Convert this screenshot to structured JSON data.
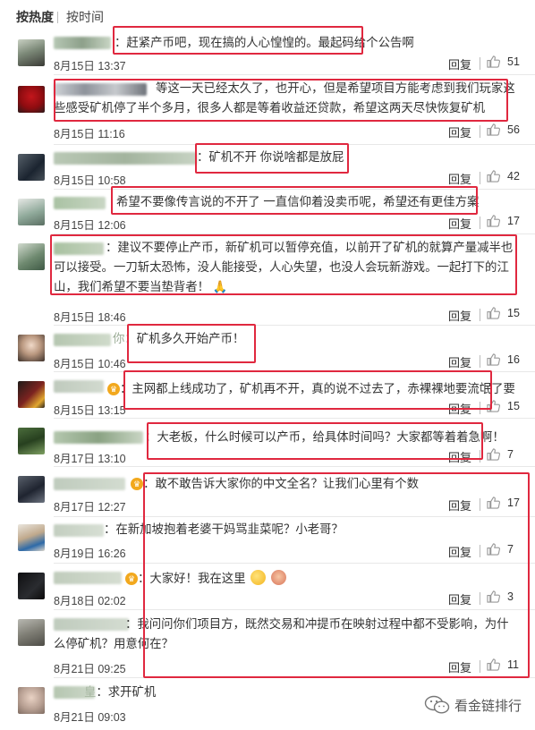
{
  "sort": {
    "hot": "按热度",
    "time": "按时间"
  },
  "reply_label": "回复",
  "comments": [
    {
      "text": "赶紧产币吧，现在搞的人心惶惶的。最起码给个公告啊",
      "date": "8月15日 13:37",
      "likes": "51"
    },
    {
      "text": "等这一天已经太久了，也开心，但是希望项目方能考虑到我们玩家这些感受矿机停了半个多月，很多人都是等着收益还贷款，希望这两天尽快恢复矿机",
      "date": "8月15日 11:16",
      "likes": "56"
    },
    {
      "text": "矿机不开 你说啥都是放屁",
      "date": "8月15日 10:58",
      "likes": "42"
    },
    {
      "text": "希望不要像传言说的不开了 一直信仰着没卖币呢，希望还有更佳方案",
      "date": "8月15日 12:06",
      "likes": "17"
    },
    {
      "text": "建议不要停止产币，新矿机可以暂停充值，以前开了矿机的就算产量减半也可以接受。一刀斩太恐怖，没人能接受，人心失望，也没人会玩新游戏。一起打下的江山，我们希望不要当垫背者！",
      "date": "8月15日 18:46",
      "likes": "15"
    },
    {
      "text": "矿机多久开始产币！",
      "date": "8月15日 10:46",
      "likes": "16"
    },
    {
      "text": "主网都上线成功了，矿机再不开，真的说不过去了，赤裸裸地要流氓了要",
      "date": "8月15日 13:15",
      "likes": "15"
    },
    {
      "text": "大老板，什么时候可以产币，给具体时间吗？大家都等着着急啊！",
      "date": "8月17日 13:10",
      "likes": "7"
    },
    {
      "text": "敢不敢告诉大家你的中文全名？让我们心里有个数",
      "date": "8月17日 12:27",
      "likes": "17"
    },
    {
      "text": "在新加坡抱着老婆干妈骂韭菜呢？小老哥？",
      "date": "8月19日 16:26",
      "likes": "7"
    },
    {
      "text": "大家好！我在这里",
      "date": "8月18日 02:02",
      "likes": "3"
    },
    {
      "text": "我问问你们项目方，既然交易和冲提币在映射过程中都不受影响，为什么停矿机？用意何在？",
      "date": "8月21日 09:25",
      "likes": "11"
    },
    {
      "text": "求开矿机",
      "date": "8月21日 09:03",
      "likes": ""
    }
  ],
  "watermark": "看金链排行",
  "colors": {
    "highlight": "#e0283f",
    "divider": "#e8e8e8"
  },
  "icons": [
    "thumb-up-icon",
    "wechat-logo-icon",
    "crown-badge-icon",
    "smile-emoji-icon",
    "pray-emoji-icon"
  ]
}
